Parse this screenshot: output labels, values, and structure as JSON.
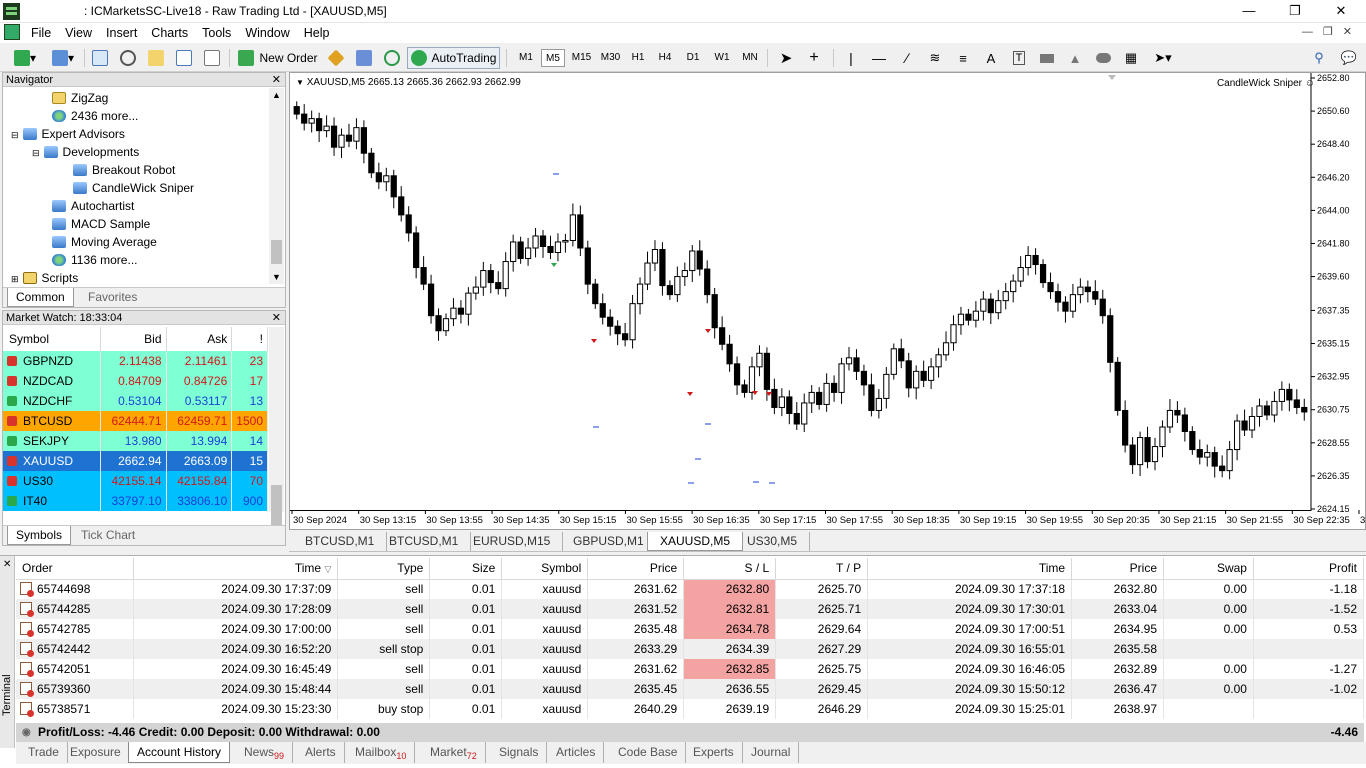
{
  "window": {
    "title": ": ICMarketsSC-Live18 - Raw Trading Ltd - [XAUUSD,M5]"
  },
  "menu": [
    "File",
    "View",
    "Insert",
    "Charts",
    "Tools",
    "Window",
    "Help"
  ],
  "toolbar": {
    "new_order": "New Order",
    "autotrading": "AutoTrading",
    "timeframes": [
      "M1",
      "M5",
      "M15",
      "M30",
      "H1",
      "H4",
      "D1",
      "W1",
      "MN"
    ],
    "active_timeframe": "M5"
  },
  "navigator": {
    "title": "Navigator",
    "items": [
      {
        "label": "ZigZag",
        "icon": "indicator-icon"
      },
      {
        "label": "2436 more...",
        "icon": "more-icon"
      },
      {
        "label": "Expert Advisors",
        "icon": "expert-advisor-icon"
      },
      {
        "label": "Developments",
        "icon": "expert-advisor-icon"
      },
      {
        "label": "Breakout Robot",
        "icon": "expert-advisor-icon"
      },
      {
        "label": "CandleWick Sniper",
        "icon": "expert-advisor-icon"
      },
      {
        "label": "Autochartist",
        "icon": "expert-advisor-icon"
      },
      {
        "label": "MACD Sample",
        "icon": "expert-advisor-icon"
      },
      {
        "label": "Moving Average",
        "icon": "expert-advisor-icon"
      },
      {
        "label": "1136 more...",
        "icon": "more-icon"
      },
      {
        "label": "Scripts",
        "icon": "script-icon"
      }
    ],
    "tabs": [
      "Common",
      "Favorites"
    ]
  },
  "market_watch": {
    "title": "Market Watch: 18:33:04",
    "columns": [
      "Symbol",
      "Bid",
      "Ask",
      "!"
    ],
    "rows": [
      {
        "symbol": "GBPNZD",
        "bid": "2.11438",
        "ask": "2.11461",
        "spread": "23",
        "dir": "down",
        "color": "#7fffd4"
      },
      {
        "symbol": "NZDCAD",
        "bid": "0.84709",
        "ask": "0.84726",
        "spread": "17",
        "dir": "down",
        "color": "#7fffd4"
      },
      {
        "symbol": "NZDCHF",
        "bid": "0.53104",
        "ask": "0.53117",
        "spread": "13",
        "dir": "up",
        "color": "#7fffd4"
      },
      {
        "symbol": "BTCUSD",
        "bid": "62444.71",
        "ask": "62459.71",
        "spread": "1500",
        "dir": "down",
        "color": "#ffa500"
      },
      {
        "symbol": "SEKJPY",
        "bid": "13.980",
        "ask": "13.994",
        "spread": "14",
        "dir": "up",
        "color": "#7fffd4"
      },
      {
        "symbol": "XAUUSD",
        "bid": "2662.94",
        "ask": "2663.09",
        "spread": "15",
        "dir": "down",
        "color": "#1e73d2"
      },
      {
        "symbol": "US30",
        "bid": "42155.14",
        "ask": "42155.84",
        "spread": "70",
        "dir": "down",
        "color": "#00bfff"
      },
      {
        "symbol": "IT40",
        "bid": "33797.10",
        "ask": "33806.10",
        "spread": "900",
        "dir": "up",
        "color": "#00bfff"
      }
    ],
    "tabs": [
      "Symbols",
      "Tick Chart"
    ]
  },
  "chart": {
    "info": "XAUUSD,M5  2665.13 2665.36 2662.93 2662.99",
    "ea_label": "CandleWick Sniper",
    "price_labels": [
      "2652.80",
      "2650.60",
      "2648.40",
      "2646.20",
      "2644.00",
      "2641.80",
      "2639.60",
      "2637.35",
      "2635.15",
      "2632.95",
      "2630.75",
      "2628.55",
      "2626.35",
      "2624.15"
    ],
    "time_labels": [
      "30 Sep 2024",
      "30 Sep 13:15",
      "30 Sep 13:55",
      "30 Sep 14:35",
      "30 Sep 15:15",
      "30 Sep 15:55",
      "30 Sep 16:35",
      "30 Sep 17:15",
      "30 Sep 17:55",
      "30 Sep 18:35",
      "30 Sep 19:15",
      "30 Sep 19:55",
      "30 Sep 20:35",
      "30 Sep 21:15",
      "30 Sep 21:55",
      "30 Sep 22:35",
      "30 Sep 23:1"
    ],
    "tabs": [
      "BTCUSD,M1",
      "BTCUSD,M1",
      "EURUSD,M15",
      "GBPUSD,M1",
      "XAUUSD,M5",
      "US30,M5"
    ],
    "active_tab": "XAUUSD,M5"
  },
  "chart_data": {
    "type": "candlestick",
    "symbol": "XAUUSD",
    "timeframe": "M5",
    "ylim": [
      2624.15,
      2652.8
    ],
    "closes": [
      2650.4,
      2649.8,
      2650.1,
      2649.3,
      2649.6,
      2648.2,
      2649.0,
      2648.6,
      2649.5,
      2647.8,
      2646.5,
      2645.9,
      2646.3,
      2644.9,
      2643.7,
      2642.5,
      2640.2,
      2639.1,
      2637.0,
      2636.0,
      2636.8,
      2637.5,
      2637.1,
      2638.5,
      2638.9,
      2640.0,
      2639.2,
      2638.8,
      2640.6,
      2641.9,
      2640.8,
      2641.5,
      2642.3,
      2641.6,
      2641.2,
      2641.9,
      2642.0,
      2643.7,
      2641.5,
      2639.1,
      2637.8,
      2636.9,
      2636.3,
      2635.8,
      2635.4,
      2637.8,
      2639.1,
      2640.5,
      2641.4,
      2639.0,
      2638.4,
      2639.6,
      2640.0,
      2641.3,
      2640.1,
      2638.4,
      2636.2,
      2635.1,
      2633.8,
      2632.4,
      2631.9,
      2633.6,
      2634.5,
      2632.1,
      2630.9,
      2631.6,
      2630.5,
      2629.8,
      2631.2,
      2631.9,
      2631.1,
      2632.5,
      2631.9,
      2633.8,
      2634.2,
      2633.3,
      2632.4,
      2630.7,
      2631.5,
      2633.1,
      2634.8,
      2634.0,
      2632.2,
      2633.3,
      2632.7,
      2633.6,
      2634.4,
      2635.2,
      2636.4,
      2637.1,
      2636.7,
      2637.3,
      2638.1,
      2637.2,
      2638.0,
      2638.6,
      2639.3,
      2640.2,
      2641.0,
      2640.4,
      2639.2,
      2638.6,
      2637.9,
      2637.3,
      2638.4,
      2638.9,
      2638.6,
      2638.1,
      2637.0,
      2633.9,
      2630.7,
      2628.4,
      2627.1,
      2628.9,
      2627.3,
      2628.3,
      2629.6,
      2630.7,
      2630.4,
      2629.3,
      2628.1,
      2627.6,
      2627.9,
      2627.0,
      2626.7,
      2628.1,
      2630.0,
      2629.4,
      2630.3,
      2631.0,
      2630.4,
      2631.3,
      2632.1,
      2631.4,
      2630.9,
      2630.6
    ],
    "trade_markers": [
      "sell",
      "sell",
      "sell",
      "sell stop",
      "sell",
      "sell",
      "buy stop"
    ]
  },
  "terminal": {
    "side_label": "Terminal",
    "columns": [
      "Order",
      "Time",
      "Type",
      "Size",
      "Symbol",
      "Price",
      "S / L",
      "T / P",
      "Time",
      "Price",
      "Swap",
      "Profit"
    ],
    "rows": [
      {
        "order": "65744698",
        "time": "2024.09.30 17:37:09",
        "type": "sell",
        "size": "0.01",
        "symbol": "xauusd",
        "price": "2631.62",
        "sl": "2632.80",
        "tp": "2625.70",
        "ctime": "2024.09.30 17:37:18",
        "cprice": "2632.80",
        "swap": "0.00",
        "profit": "-1.18",
        "sl_hit": true
      },
      {
        "order": "65744285",
        "time": "2024.09.30 17:28:09",
        "type": "sell",
        "size": "0.01",
        "symbol": "xauusd",
        "price": "2631.52",
        "sl": "2632.81",
        "tp": "2625.71",
        "ctime": "2024.09.30 17:30:01",
        "cprice": "2633.04",
        "swap": "0.00",
        "profit": "-1.52",
        "sl_hit": true
      },
      {
        "order": "65742785",
        "time": "2024.09.30 17:00:00",
        "type": "sell",
        "size": "0.01",
        "symbol": "xauusd",
        "price": "2635.48",
        "sl": "2634.78",
        "tp": "2629.64",
        "ctime": "2024.09.30 17:00:51",
        "cprice": "2634.95",
        "swap": "0.00",
        "profit": "0.53",
        "sl_hit": true
      },
      {
        "order": "65742442",
        "time": "2024.09.30 16:52:20",
        "type": "sell stop",
        "size": "0.01",
        "symbol": "xauusd",
        "price": "2633.29",
        "sl": "2634.39",
        "tp": "2627.29",
        "ctime": "2024.09.30 16:55:01",
        "cprice": "2635.58",
        "swap": "",
        "profit": "",
        "sl_hit": false
      },
      {
        "order": "65742051",
        "time": "2024.09.30 16:45:49",
        "type": "sell",
        "size": "0.01",
        "symbol": "xauusd",
        "price": "2631.62",
        "sl": "2632.85",
        "tp": "2625.75",
        "ctime": "2024.09.30 16:46:05",
        "cprice": "2632.89",
        "swap": "0.00",
        "profit": "-1.27",
        "sl_hit": true
      },
      {
        "order": "65739360",
        "time": "2024.09.30 15:48:44",
        "type": "sell",
        "size": "0.01",
        "symbol": "xauusd",
        "price": "2635.45",
        "sl": "2636.55",
        "tp": "2629.45",
        "ctime": "2024.09.30 15:50:12",
        "cprice": "2636.47",
        "swap": "0.00",
        "profit": "-1.02",
        "sl_hit": false
      },
      {
        "order": "65738571",
        "time": "2024.09.30 15:23:30",
        "type": "buy stop",
        "size": "0.01",
        "symbol": "xauusd",
        "price": "2640.29",
        "sl": "2639.19",
        "tp": "2646.29",
        "ctime": "2024.09.30 15:25:01",
        "cprice": "2638.97",
        "swap": "",
        "profit": "",
        "sl_hit": false
      }
    ],
    "summary": "Profit/Loss: -4.46  Credit: 0.00  Deposit: 0.00  Withdrawal: 0.00",
    "summary_total": "-4.46",
    "tabs": [
      {
        "label": "Trade",
        "badge": ""
      },
      {
        "label": "Exposure",
        "badge": ""
      },
      {
        "label": "Account History",
        "badge": ""
      },
      {
        "label": "News",
        "badge": "99"
      },
      {
        "label": "Alerts",
        "badge": ""
      },
      {
        "label": "Mailbox",
        "badge": "10"
      },
      {
        "label": "Market",
        "badge": "72"
      },
      {
        "label": "Signals",
        "badge": ""
      },
      {
        "label": "Articles",
        "badge": ""
      },
      {
        "label": "Code Base",
        "badge": ""
      },
      {
        "label": "Experts",
        "badge": ""
      },
      {
        "label": "Journal",
        "badge": ""
      }
    ],
    "active_tab": "Account History"
  }
}
